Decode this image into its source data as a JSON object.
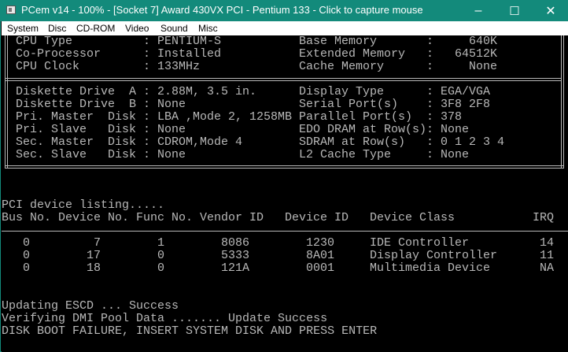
{
  "window": {
    "title": "PCem v14 - 100% - [Socket 7] Award 430VX PCI - Pentium 133 - Click to capture mouse",
    "accent_color": "#138a7b",
    "controls": {
      "minimize": "–",
      "maximize": "☐",
      "close": "✕"
    }
  },
  "menu": [
    "System",
    "Disc",
    "CD-ROM",
    "Video",
    "Sound",
    "Misc"
  ],
  "cmos": {
    "top_left": [
      {
        "label": "CPU Type",
        "value": "PENTIUM-S"
      },
      {
        "label": "Co-Processor",
        "value": "Installed"
      },
      {
        "label": "CPU Clock",
        "value": "133MHz"
      }
    ],
    "top_right": [
      {
        "label": "Base Memory",
        "value": "  640K"
      },
      {
        "label": "Extended Memory",
        "value": "64512K"
      },
      {
        "label": "Cache Memory",
        "value": "  None"
      }
    ],
    "bottom_left": [
      {
        "label": "Diskette Drive  A",
        "value": "2.88M, 3.5 in."
      },
      {
        "label": "Diskette Drive  B",
        "value": "None"
      },
      {
        "label": "Pri. Master  Disk",
        "value": "LBA ,Mode 2, 1258MB"
      },
      {
        "label": "Pri. Slave   Disk",
        "value": "None"
      },
      {
        "label": "Sec. Master  Disk",
        "value": "CDROM,Mode 4"
      },
      {
        "label": "Sec. Slave   Disk",
        "value": "None"
      }
    ],
    "bottom_right": [
      {
        "label": "Display Type",
        "value": "EGA/VGA"
      },
      {
        "label": "Serial Port(s)",
        "value": "3F8 2F8"
      },
      {
        "label": "Parallel Port(s)",
        "value": "378"
      },
      {
        "label": "EDO DRAM at Row(s)",
        "value": "None"
      },
      {
        "label": "SDRAM at Row(s)",
        "value": "0 1 2 3 4"
      },
      {
        "label": "L2 Cache Type",
        "value": "None"
      }
    ],
    "separator": ":"
  },
  "pci": {
    "heading": "PCI device listing.....",
    "headers": [
      "Bus No.",
      "Device No.",
      "Func No.",
      "Vendor ID",
      "Device ID",
      "Device Class",
      "IRQ"
    ],
    "rows": [
      [
        "0",
        " 7",
        "1",
        "8086",
        "1230",
        "IDE Controller",
        "14"
      ],
      [
        "0",
        "17",
        "0",
        "5333",
        "8A01",
        "Display Controller",
        "11"
      ],
      [
        "0",
        "18",
        "0",
        "121A",
        "0001",
        "Multimedia Device",
        "NA"
      ]
    ]
  },
  "messages": [
    "Updating ESCD ... Success",
    "Verifying DMI Pool Data ....... Update Success",
    "DISK BOOT FAILURE, INSERT SYSTEM DISK AND PRESS ENTER"
  ]
}
